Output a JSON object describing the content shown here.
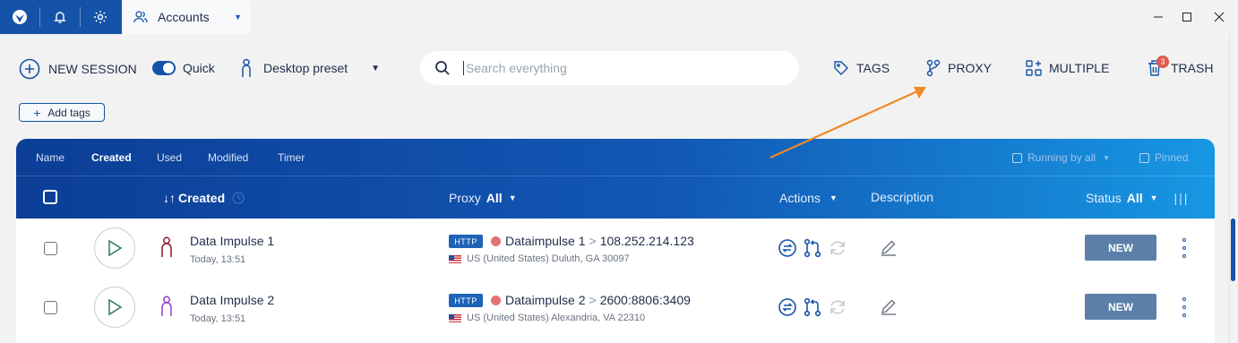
{
  "titlebar": {
    "tab_label": "Accounts",
    "icons": [
      "app-logo-icon",
      "bell-icon",
      "gear-icon"
    ]
  },
  "toolbar": {
    "new_session": "NEW SESSION",
    "quick": "Quick",
    "quick_enabled": true,
    "preset": "Desktop preset",
    "search_placeholder": "Search everything",
    "tags": "TAGS",
    "proxy": "PROXY",
    "multiple": "MULTIPLE",
    "trash": "TRASH",
    "trash_count": "3",
    "add_tags": "Add tags"
  },
  "table": {
    "sort_tabs": [
      "Name",
      "Created",
      "Used",
      "Modified",
      "Timer"
    ],
    "active_sort": "Created",
    "running_by_all": "Running by all",
    "pinned": "Pinned",
    "col_created": "Created",
    "col_proxy": "Proxy",
    "col_proxy_filter": "All",
    "col_actions": "Actions",
    "col_description": "Description",
    "col_status": "Status",
    "col_status_filter": "All",
    "rows": [
      {
        "name": "Data Impulse 1",
        "time": "Today, 13:51",
        "avatar_color": "#8a1a2a",
        "proxy_type": "HTTP",
        "proxy_name": "Dataimpulse 1",
        "proxy_ip": "108.252.214.123",
        "location": "US (United States) Duluth, GA 30097",
        "status": "NEW"
      },
      {
        "name": "Data Impulse 2",
        "time": "Today, 13:51",
        "avatar_color": "#9b3bc9",
        "proxy_type": "HTTP",
        "proxy_name": "Dataimpulse 2",
        "proxy_ip": "2600:8806:3409",
        "location": "US (United States) Alexandria, VA 22310",
        "status": "NEW"
      }
    ]
  },
  "colors": {
    "brand": "#1553a8",
    "annotation_arrow": "#f08a24",
    "status_new": "#5b7fa9",
    "proxy_dot": "#e57272"
  }
}
